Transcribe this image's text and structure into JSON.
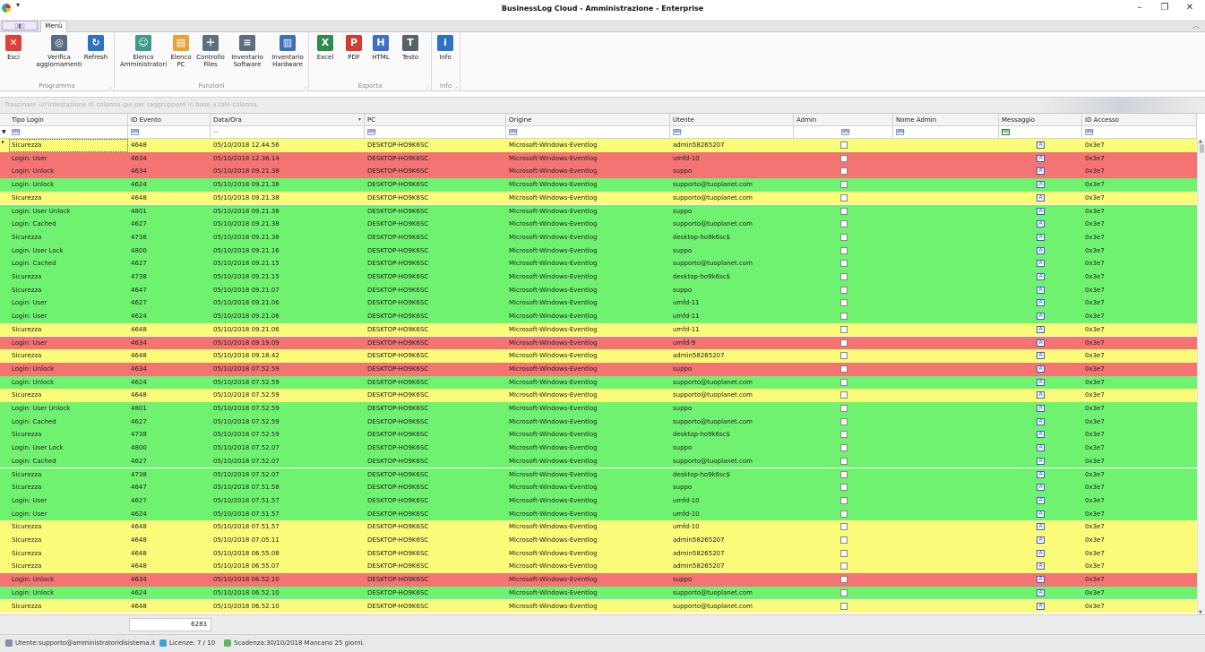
{
  "window": {
    "title": "BusinessLog Cloud - Amministrazione - Enterprise",
    "qa_arrow": "▾",
    "minimize": "–",
    "restore": "❐",
    "close": "✕"
  },
  "ribbon": {
    "tabs": {
      "app_menu": "▯▮▯",
      "menu": "Menù"
    },
    "collapse": "︿",
    "groups": [
      {
        "caption": "Programma",
        "buttons": [
          {
            "label": "Esci",
            "icon": "close-icon",
            "color": "#e0403a"
          },
          {
            "label": "Verifica aggiornamenti",
            "icon": "globe-icon",
            "color": "#5a6b86"
          },
          {
            "label": "Refresh",
            "icon": "refresh-icon",
            "color": "#2e72c6"
          }
        ]
      },
      {
        "caption": "Funzioni",
        "buttons": [
          {
            "label": "Elenco Amministratori",
            "icon": "users-icon",
            "color": "#3c9a86"
          },
          {
            "label": "Elenco PC",
            "icon": "clipboard-icon",
            "color": "#e5a33a"
          },
          {
            "label": "Controllo Files",
            "icon": "file-add-icon",
            "color": "#5d6e7e"
          },
          {
            "label": "Inventario Software",
            "icon": "list-icon",
            "color": "#5d6e7e"
          },
          {
            "label": "Inventario Hardware",
            "icon": "hardware-icon",
            "color": "#3c6fb6"
          }
        ]
      },
      {
        "caption": "Esporta",
        "buttons": [
          {
            "label": "Excel",
            "icon": "excel-icon",
            "color": "#2f8a4e"
          },
          {
            "label": "PDF",
            "icon": "pdf-icon",
            "color": "#d23c32"
          },
          {
            "label": "HTML",
            "icon": "html-icon",
            "color": "#3e6fc3"
          },
          {
            "label": "Testo",
            "icon": "text-icon",
            "color": "#58606b"
          }
        ]
      },
      {
        "caption": "Info",
        "buttons": [
          {
            "label": "Info",
            "icon": "info-icon",
            "color": "#2e72c6"
          }
        ]
      }
    ]
  },
  "grid": {
    "group_hint": "Trascinare un'intestazione di colonna qui per raggruppare in base a tale colonna.",
    "columns": [
      "Tipo Login",
      "ID Evento",
      "Data/Ora",
      "PC",
      "Origine",
      "Utente",
      "Admin",
      "Nome Admin",
      "Messaggio",
      "ID Accesso"
    ],
    "filter_row": {
      "abc": "abc",
      "date": "—"
    },
    "row_colors": {
      "green": "#6ff26f",
      "yellow": "#fbfb7a",
      "red": "#f47373"
    },
    "rows": [
      [
        "yellow",
        "Sicurezza",
        "4648",
        "05/10/2018 12.44.56",
        "admin58265207"
      ],
      [
        "red",
        "Login: User",
        "4634",
        "05/10/2018 12.36.14",
        "umfd-10"
      ],
      [
        "red",
        "Login: Unlock",
        "4634",
        "05/10/2018 09.21.38",
        "suppo"
      ],
      [
        "green",
        "Login: Unlock",
        "4624",
        "05/10/2018 09.21.38",
        "supporto@tuoplanet.com"
      ],
      [
        "yellow",
        "Sicurezza",
        "4648",
        "05/10/2018 09.21.38",
        "supporto@tuoplanet.com"
      ],
      [
        "green",
        "Login: User Unlock",
        "4801",
        "05/10/2018 09.21.38",
        "suppo"
      ],
      [
        "green",
        "Login: Cached",
        "4627",
        "05/10/2018 09.21.38",
        "supporto@tuoplanet.com"
      ],
      [
        "green",
        "Sicurezza",
        "4738",
        "05/10/2018 09.21.38",
        "desktop-ho9k6sc$"
      ],
      [
        "green",
        "Login: User Lock",
        "4800",
        "05/10/2018 09.21.16",
        "suppo"
      ],
      [
        "green",
        "Login: Cached",
        "4627",
        "05/10/2018 09.21.15",
        "supporto@tuoplanet.com"
      ],
      [
        "green",
        "Sicurezza",
        "4738",
        "05/10/2018 09.21.15",
        "desktop-ho9k6sc$"
      ],
      [
        "green",
        "Sicurezza",
        "4647",
        "05/10/2018 09.21.07",
        "suppo"
      ],
      [
        "green",
        "Login: User",
        "4627",
        "05/10/2018 09.21.06",
        "umfd-11"
      ],
      [
        "green",
        "Login: User",
        "4624",
        "05/10/2018 09.21.06",
        "umfd-11"
      ],
      [
        "yellow",
        "Sicurezza",
        "4648",
        "05/10/2018 09.21.06",
        "umfd-11"
      ],
      [
        "red",
        "Login: User",
        "4634",
        "05/10/2018 09.19.09",
        "umfd-9"
      ],
      [
        "yellow",
        "Sicurezza",
        "4648",
        "05/10/2018 09.18.42",
        "admin58265207"
      ],
      [
        "red",
        "Login: Unlock",
        "4634",
        "05/10/2018 07.52.59",
        "suppo"
      ],
      [
        "green",
        "Login: Unlock",
        "4624",
        "05/10/2018 07.52.59",
        "supporto@tuoplanet.com"
      ],
      [
        "yellow",
        "Sicurezza",
        "4648",
        "05/10/2018 07.52.59",
        "supporto@tuoplanet.com"
      ],
      [
        "green",
        "Login: User Unlock",
        "4801",
        "05/10/2018 07.52.59",
        "suppo"
      ],
      [
        "green",
        "Login: Cached",
        "4627",
        "05/10/2018 07.52.59",
        "supporto@tuoplanet.com"
      ],
      [
        "green",
        "Sicurezza",
        "4738",
        "05/10/2018 07.52.59",
        "desktop-ho9k6sc$"
      ],
      [
        "green",
        "Login: User Lock",
        "4800",
        "05/10/2018 07.52.07",
        "suppo"
      ],
      [
        "green",
        "Login: Cached",
        "4627",
        "05/10/2018 07.52.07",
        "supporto@tuoplanet.com"
      ],
      [
        "green",
        "Sicurezza",
        "4738",
        "05/10/2018 07.52.07",
        "desktop-ho9k6sc$"
      ],
      [
        "green",
        "Sicurezza",
        "4647",
        "05/10/2018 07.51.58",
        "suppo"
      ],
      [
        "green",
        "Login: User",
        "4627",
        "05/10/2018 07.51.57",
        "umfd-10"
      ],
      [
        "green",
        "Login: User",
        "4624",
        "05/10/2018 07.51.57",
        "umfd-10"
      ],
      [
        "yellow",
        "Sicurezza",
        "4648",
        "05/10/2018 07.51.57",
        "umfd-10"
      ],
      [
        "yellow",
        "Sicurezza",
        "4648",
        "05/10/2018 07.05.11",
        "admin58265207"
      ],
      [
        "yellow",
        "Sicurezza",
        "4648",
        "05/10/2018 06.55.08",
        "admin58265207"
      ],
      [
        "yellow",
        "Sicurezza",
        "4648",
        "05/10/2018 06.55.07",
        "admin58265207"
      ],
      [
        "red",
        "Login: Unlock",
        "4634",
        "05/10/2018 06.52.10",
        "suppo"
      ],
      [
        "green",
        "Login: Unlock",
        "4624",
        "05/10/2018 06.52.10",
        "supporto@tuoplanet.com"
      ],
      [
        "yellow",
        "Sicurezza",
        "4648",
        "05/10/2018 06.52.10",
        "supporto@tuoplanet.com"
      ]
    ],
    "common": {
      "pc": "DESKTOP-HO9K6SC",
      "origine": "Microsoft-Windows-Eventlog",
      "id_accesso": "0x3e7"
    },
    "row_indicator": "▸",
    "record_count": "6283"
  },
  "status": {
    "user": "Utente:supporto@amministratoridisistema.it",
    "licenses": "Licenze: 7 / 10",
    "expiry": "Scadenza:30/10/2018 Mancano 25 giorni."
  }
}
